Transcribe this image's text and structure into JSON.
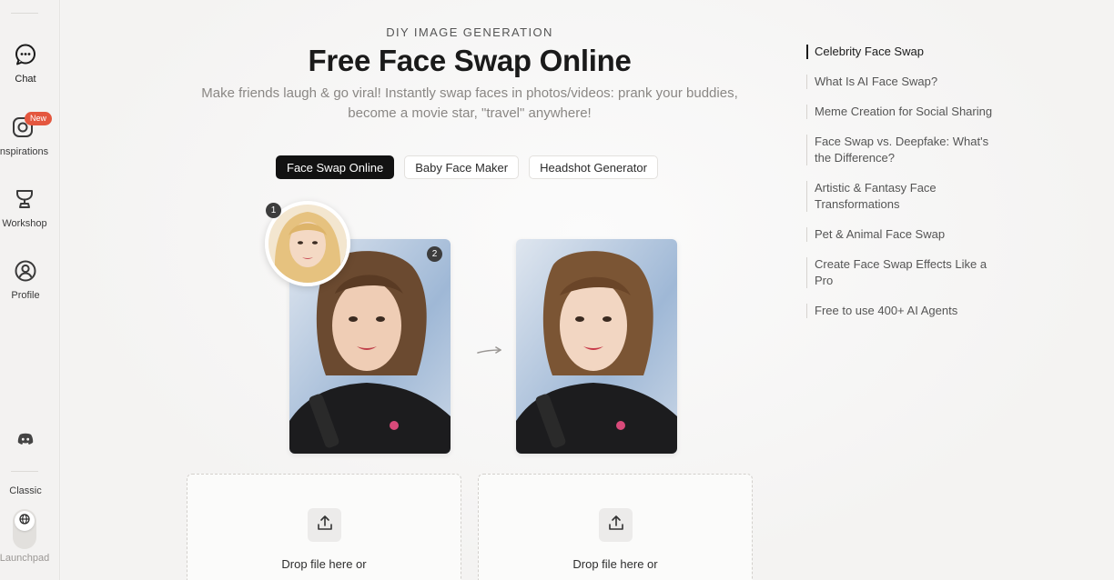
{
  "sidebar": {
    "items": [
      {
        "label": "Chat",
        "icon": "chat-icon"
      },
      {
        "label": "Inspirations",
        "icon": "instagram-icon",
        "badge": "New"
      },
      {
        "label": "Workshop",
        "icon": "trophy-icon"
      },
      {
        "label": "Profile",
        "icon": "user-icon"
      }
    ],
    "discord_icon": "discord-icon",
    "classic_label": "Classic",
    "launchpad_label": "Launchpad"
  },
  "header": {
    "eyebrow": "DIY IMAGE GENERATION",
    "title": "Free Face Swap Online",
    "subtitle": "Make friends laugh & go viral! Instantly swap faces in photos/videos: prank your buddies, become a movie star, \"travel\" anywhere!"
  },
  "tabs": [
    {
      "label": "Face Swap Online",
      "active": true
    },
    {
      "label": "Baby Face Maker",
      "active": false
    },
    {
      "label": "Headshot Generator",
      "active": false
    }
  ],
  "demo": {
    "badge_1": "1",
    "badge_2": "2"
  },
  "upload": {
    "box_1_text": "Drop file here or",
    "box_2_text": "Drop file here or"
  },
  "toc": {
    "items": [
      {
        "label": "Celebrity Face Swap",
        "active": true
      },
      {
        "label": "What Is AI Face Swap?",
        "active": false
      },
      {
        "label": "Meme Creation for Social Sharing",
        "active": false
      },
      {
        "label": "Face Swap vs. Deepfake: What's the Difference?",
        "active": false
      },
      {
        "label": "Artistic & Fantasy Face Transformations",
        "active": false
      },
      {
        "label": "Pet & Animal Face Swap",
        "active": false
      },
      {
        "label": "Create Face Swap Effects Like a Pro",
        "active": false
      },
      {
        "label": "Free to use 400+ AI Agents",
        "active": false
      }
    ]
  },
  "colors": {
    "accent_dark": "#121212",
    "badge_red": "#e4573f",
    "muted_text": "#8a8784"
  }
}
